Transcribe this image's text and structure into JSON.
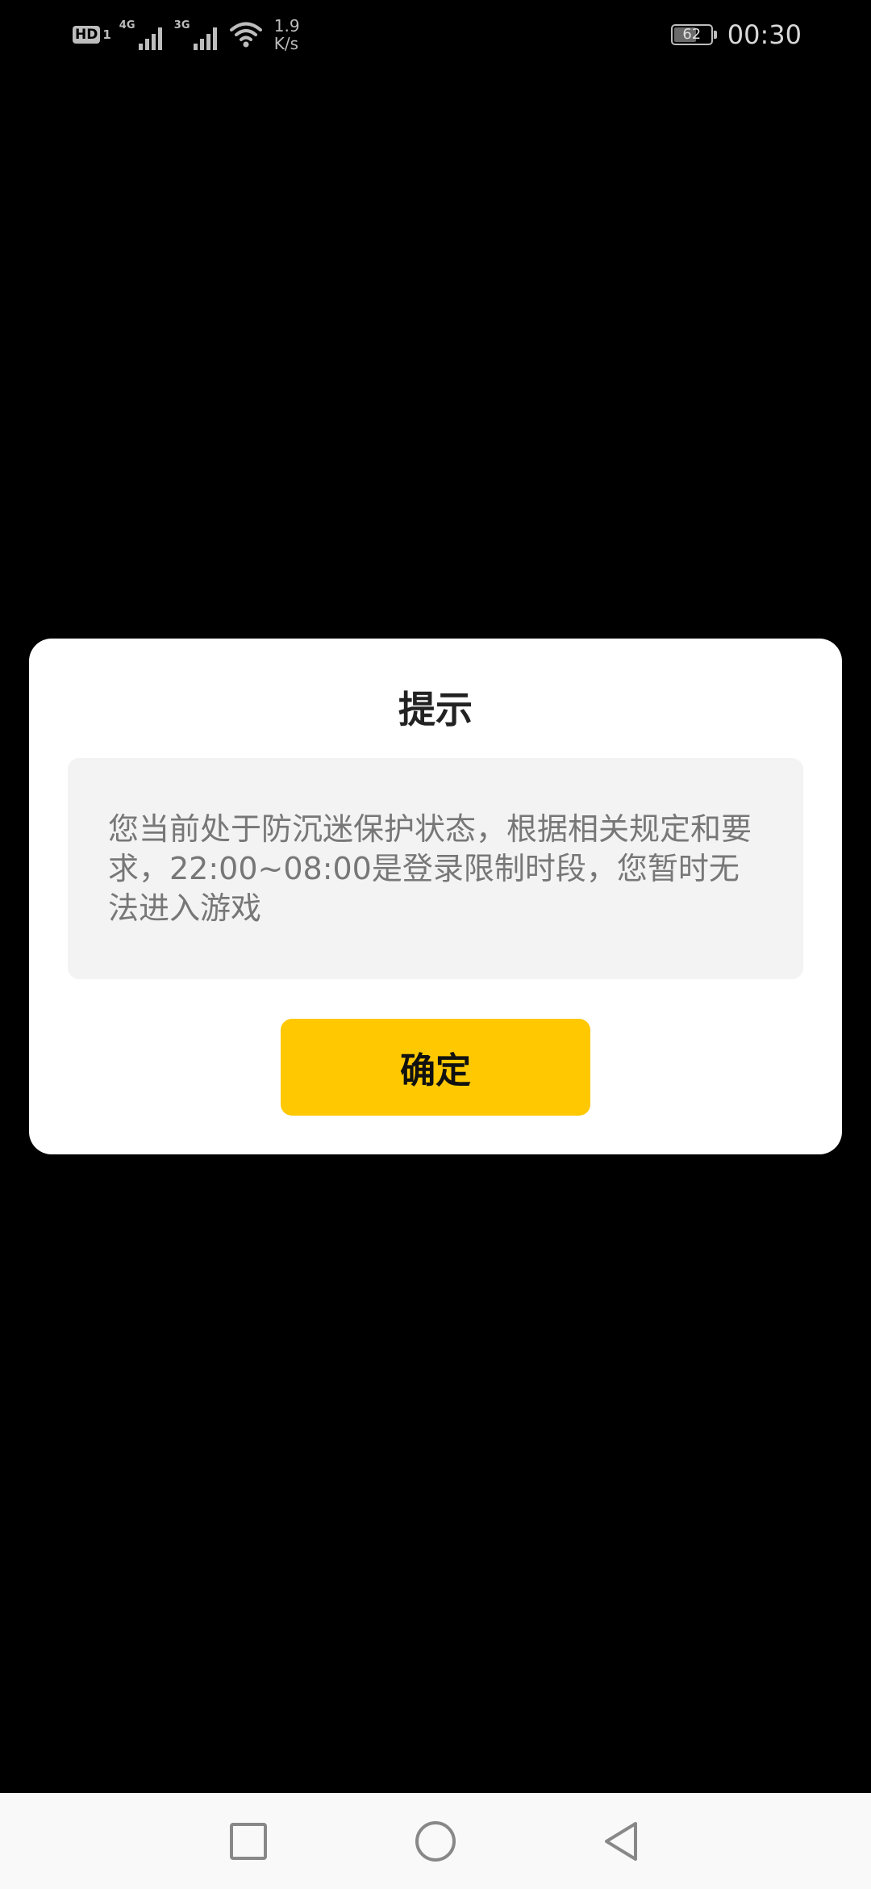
{
  "status_bar": {
    "hd_label": "HD",
    "hd_sim": "1",
    "sim1_network": "4G",
    "sim2_network": "3G",
    "speed_value": "1.9",
    "speed_unit": "K/s",
    "battery_level": "62",
    "battery_fraction": 0.62,
    "time": "00:30",
    "icons": [
      "hd-icon",
      "signal-icon",
      "signal-icon",
      "wifi-icon",
      "battery-icon"
    ]
  },
  "dialog": {
    "title": "提示",
    "message": "您当前处于防沉迷保护状态，根据相关规定和要求，22:00~08:00是登录限制时段，您暂时无法进入游戏",
    "confirm_label": "确定",
    "confirm_color": "#ffc800"
  },
  "nav_bar": {
    "icons": [
      "recents-icon",
      "home-icon",
      "back-icon"
    ]
  }
}
